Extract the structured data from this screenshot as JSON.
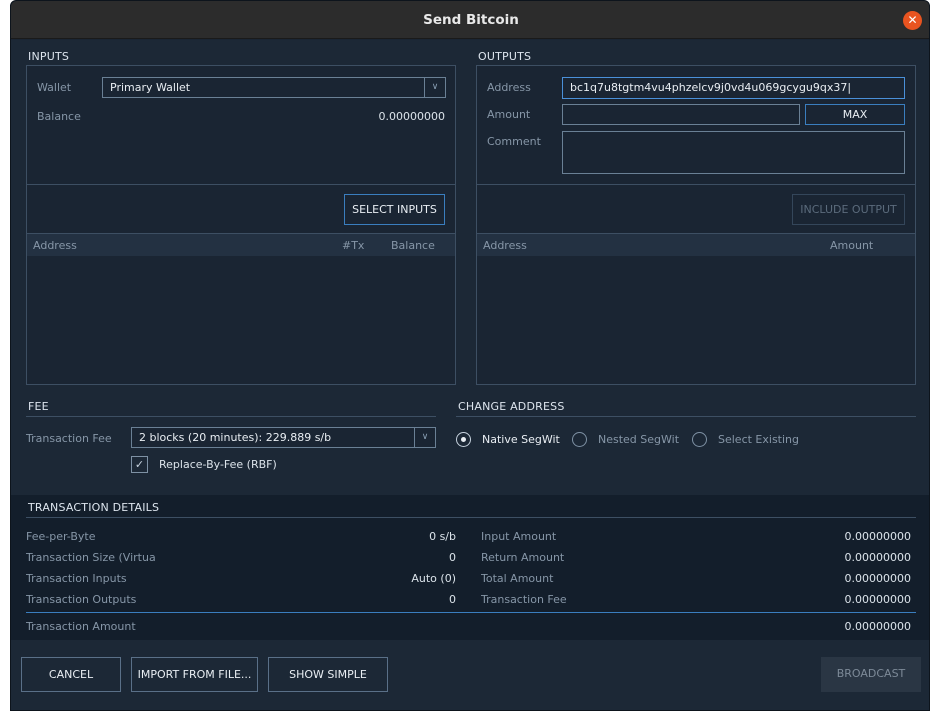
{
  "window": {
    "title": "Send Bitcoin"
  },
  "inputs": {
    "header": "INPUTS",
    "wallet_label": "Wallet",
    "wallet_value": "Primary Wallet",
    "balance_label": "Balance",
    "balance_value": "0.00000000",
    "select_inputs_label": "SELECT INPUTS",
    "table_headers": {
      "address": "Address",
      "tx": "#Tx",
      "balance": "Balance"
    }
  },
  "outputs": {
    "header": "OUTPUTS",
    "address_label": "Address",
    "address_value": "bc1q7u8tgtm4vu4phzelcv9j0vd4u069gcygu9qx37",
    "amount_label": "Amount",
    "amount_value": "",
    "max_label": "MAX",
    "comment_label": "Comment",
    "comment_value": "",
    "include_output_label": "INCLUDE OUTPUT",
    "table_headers": {
      "address": "Address",
      "amount": "Amount"
    }
  },
  "fee": {
    "header": "FEE",
    "transaction_fee_label": "Transaction Fee",
    "transaction_fee_value": "2 blocks (20 minutes): 229.889 s/b",
    "rbf_label": "Replace-By-Fee (RBF)",
    "rbf_checked": true
  },
  "change_address": {
    "header": "CHANGE ADDRESS",
    "options": [
      "Native SegWit",
      "Nested SegWit",
      "Select Existing"
    ],
    "selected": "Native SegWit"
  },
  "details": {
    "header": "TRANSACTION DETAILS",
    "left": [
      {
        "label": "Fee-per-Byte",
        "value": "0 s/b"
      },
      {
        "label": "Transaction Size (Virtua",
        "value": "0"
      },
      {
        "label": "Transaction Inputs",
        "value": "Auto (0)"
      },
      {
        "label": "Transaction Outputs",
        "value": "0"
      }
    ],
    "right": [
      {
        "label": "Input Amount",
        "value": "0.00000000"
      },
      {
        "label": "Return Amount",
        "value": "0.00000000"
      },
      {
        "label": "Total Amount",
        "value": "0.00000000"
      },
      {
        "label": "Transaction Fee",
        "value": "0.00000000"
      }
    ],
    "amount_label": "Transaction Amount",
    "amount_value": "0.00000000"
  },
  "footer": {
    "cancel_label": "CANCEL",
    "import_label": "IMPORT FROM FILE...",
    "show_simple_label": "SHOW SIMPLE",
    "broadcast_label": "BROADCAST"
  },
  "colors": {
    "accent": "#3a7ebf",
    "close": "#e95420",
    "background": "#1a2533"
  }
}
